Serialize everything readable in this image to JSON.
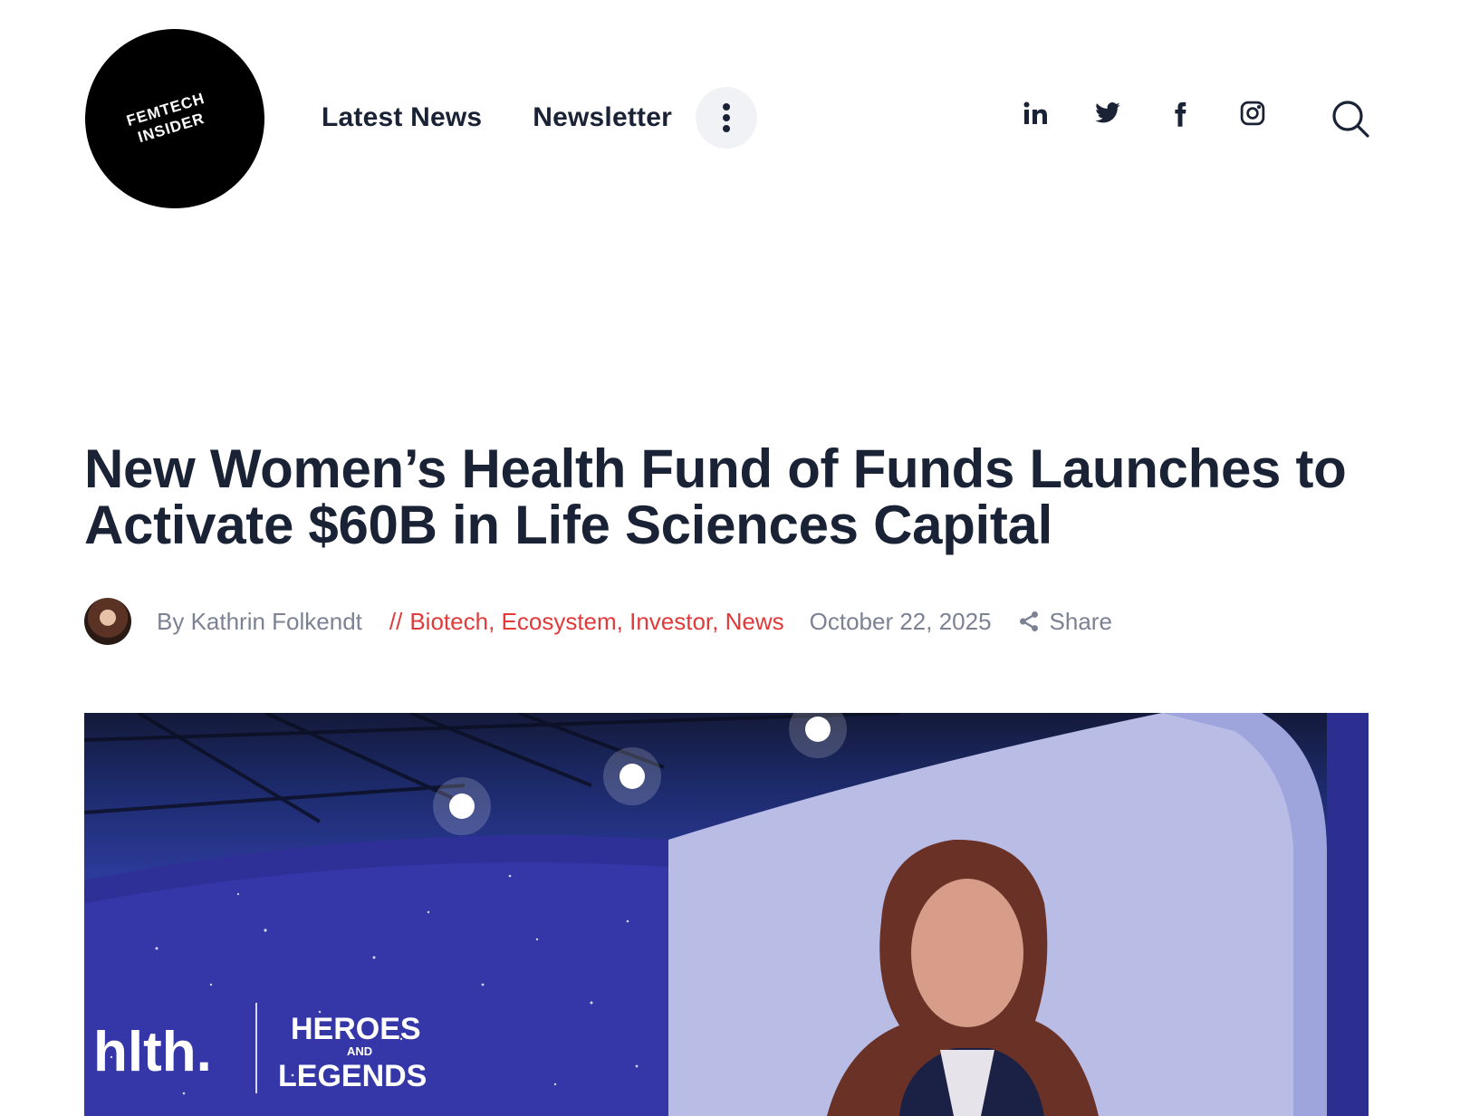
{
  "logo": {
    "line1": "FEMTECH",
    "line2": "INSIDER"
  },
  "nav": {
    "items": [
      "Latest News",
      "Newsletter"
    ],
    "more_icon": "vertical-dots-icon"
  },
  "social": [
    "linkedin-icon",
    "twitter-icon",
    "facebook-icon",
    "instagram-icon"
  ],
  "search_icon": "search-icon",
  "article": {
    "title": "New Women’s Health Fund of Funds Launches to Activate $60B in Life Sciences Capital",
    "author": "By Kathrin Folkendt",
    "category_prefix": "//",
    "categories": "Biotech, Ecosystem, Investor, News",
    "date": "October 22, 2025",
    "share": "Share"
  },
  "hero": {
    "brand": "hlth.",
    "event_line1": "HEROES",
    "event_and": "AND",
    "event_line2": "LEGENDS"
  },
  "colors": {
    "text": "#1a2235",
    "muted": "#7b8293",
    "category": "#e03a3a"
  }
}
